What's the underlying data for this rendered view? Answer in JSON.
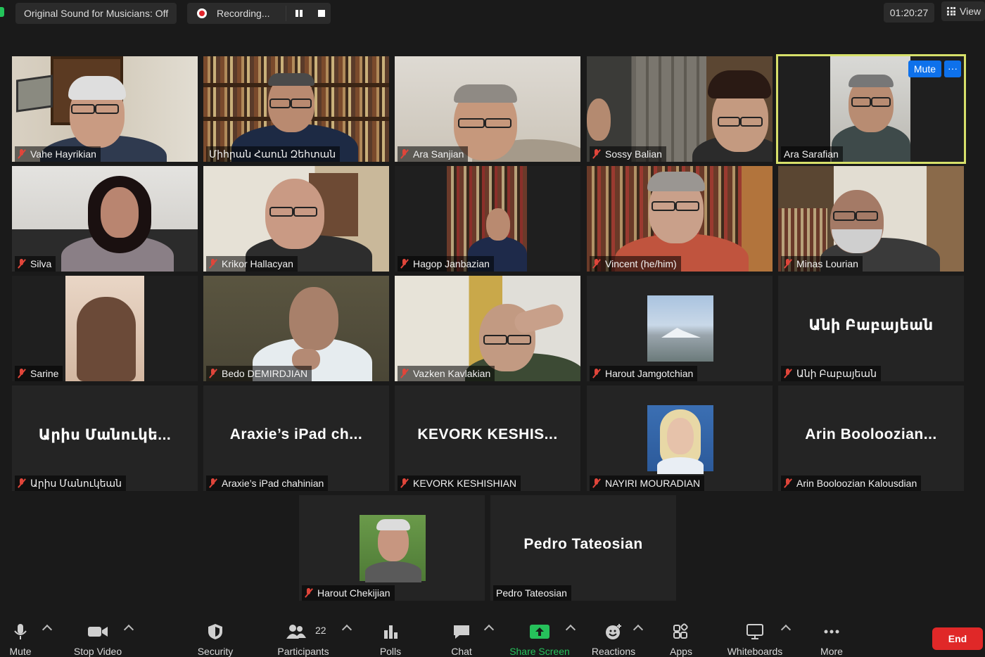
{
  "topbar": {
    "original_sound": "Original Sound for Musicians: Off",
    "recording": "Recording...",
    "timer": "01:20:27",
    "view": "View"
  },
  "participants": [
    {
      "name": "Vahe Hayrikian"
    },
    {
      "name": "Միհրան Հաուն Զեհտան"
    },
    {
      "name": "Ara Sanjian"
    },
    {
      "name": "Sossy Balian"
    },
    {
      "name": "Ara Sarafian",
      "mute_label": "Mute",
      "more_label": "···"
    },
    {
      "name": "Silva"
    },
    {
      "name": "Krikor Hallacyan"
    },
    {
      "name": "Hagop Janbazian"
    },
    {
      "name": "Vincent (he/him)"
    },
    {
      "name": "Minas Lourian"
    },
    {
      "name": "Sarine"
    },
    {
      "name": "Bedo DEMIRDJIAN"
    },
    {
      "name": "Vazken Kavlakian"
    },
    {
      "name": "Harout Jamgotchian"
    },
    {
      "name": "Անի Բաբայեան",
      "display": "Անի Բաբայեան"
    },
    {
      "name": "Արիս Մանուկեան",
      "display": "Արիս Մանուկե..."
    },
    {
      "name": "Araxie’s iPad chahinian",
      "display": "Araxie’s iPad ch..."
    },
    {
      "name": "KEVORK KESHISHIAN",
      "display": "KEVORK KESHIS..."
    },
    {
      "name": "NAYIRI MOURADIAN"
    },
    {
      "name": "Arin Booloozian Kalousdian",
      "display": "Arin Booloozian..."
    },
    {
      "name": "Harout Chekijian"
    },
    {
      "name": "Pedro Tateosian",
      "display": "Pedro Tateosian"
    }
  ],
  "toolbar": {
    "mute": "Mute",
    "stop_video": "Stop Video",
    "security": "Security",
    "participants": "Participants",
    "participants_count": "22",
    "polls": "Polls",
    "chat": "Chat",
    "share_screen": "Share Screen",
    "reactions": "Reactions",
    "apps": "Apps",
    "whiteboards": "Whiteboards",
    "more": "More",
    "end": "End"
  },
  "colors": {
    "accent_blue": "#0e71eb",
    "share_green": "#26c15b",
    "end_red": "#e02828",
    "active_speaker": "#d7e06a",
    "muted_red": "#e0453a"
  }
}
